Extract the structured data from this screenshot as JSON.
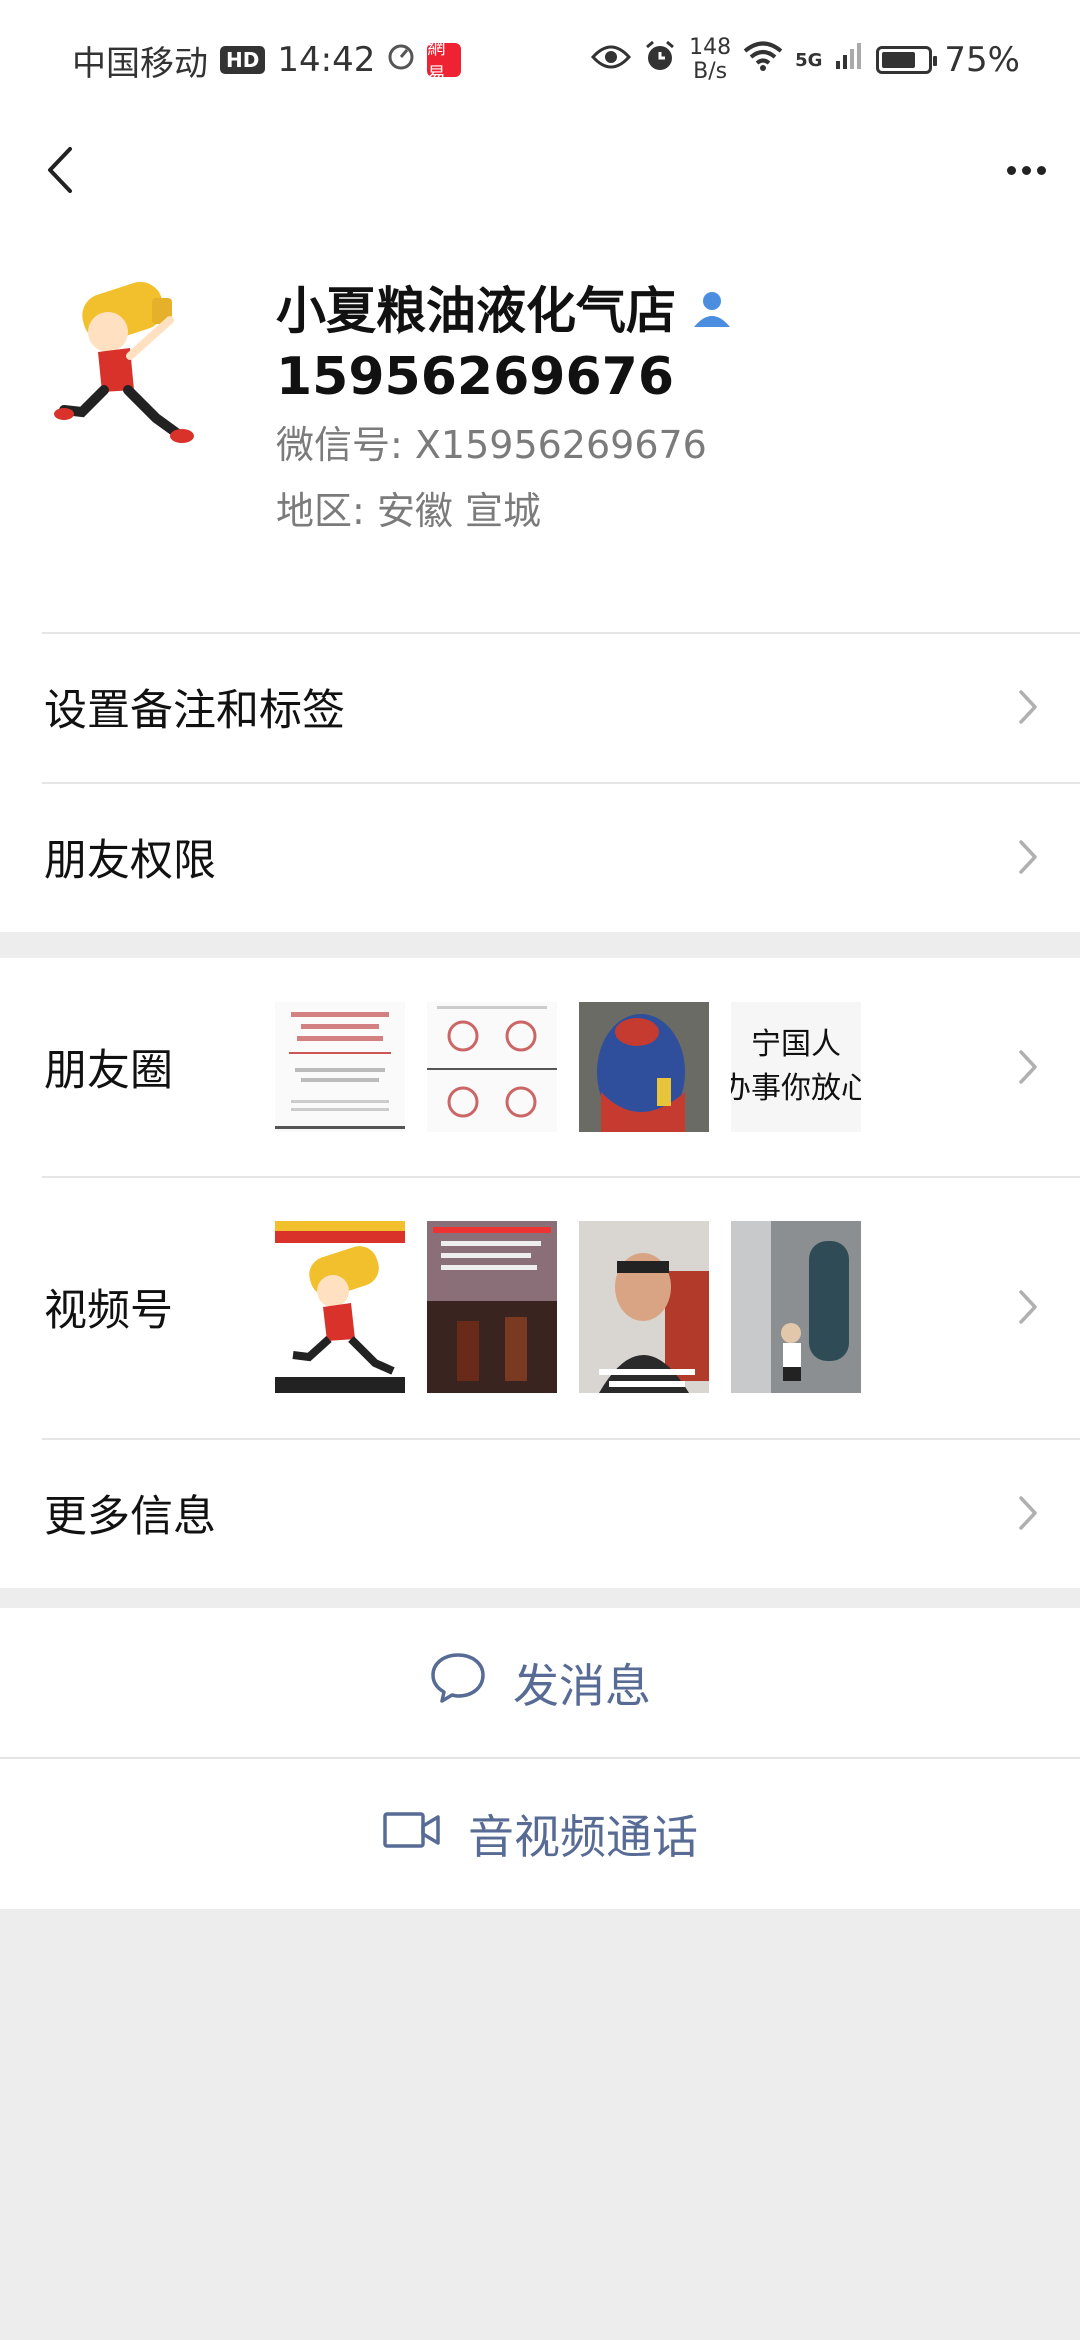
{
  "status_bar": {
    "carrier": "中国移动",
    "hd": "HD",
    "time": "14:42",
    "app_badge": "網易",
    "speed_value": "148",
    "speed_unit": "B/s",
    "network": "5G",
    "battery_text": "75%",
    "battery_level": 0.75
  },
  "profile": {
    "name": "小夏粮油液化气店",
    "phone": "15956269676",
    "wechat_id": "微信号: X15956269676",
    "region": "地区: 安徽  宣城"
  },
  "rows": {
    "remark": "设置备注和标签",
    "permissions": "朋友权限",
    "moments": "朋友圈",
    "channels": "视频号",
    "more_info": "更多信息"
  },
  "moments_thumbs": {
    "text_thumb_line1": "宁国人",
    "text_thumb_line2": "办事你放心"
  },
  "actions": {
    "message": "发消息",
    "call": "音视频通话"
  },
  "colors": {
    "accent": "#576b95",
    "background": "#ededed",
    "verified_icon": "#4b8ee0"
  }
}
